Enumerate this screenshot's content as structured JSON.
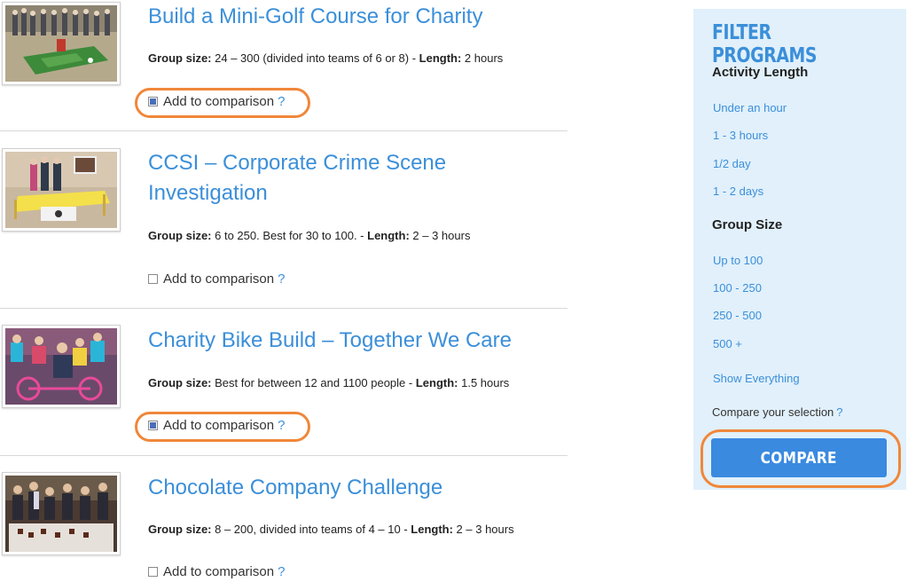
{
  "programs": [
    {
      "title": "Build a Mini-Golf Course for Charity",
      "group_size_label": "Group size:",
      "group_size_value": " 24 – 300 (divided into teams of 6 or 8) - ",
      "length_label": "Length:",
      "length_value": " 2 hours",
      "compare_label": "Add to comparison",
      "help_mark": "?",
      "checked": true
    },
    {
      "title": "CCSI – Corporate Crime Scene Investigation",
      "group_size_label": "Group size:",
      "group_size_value": " 6 to 250. Best for 30 to 100. - ",
      "length_label": "Length:",
      "length_value": " 2 – 3 hours",
      "compare_label": "Add to comparison",
      "help_mark": "?",
      "checked": false
    },
    {
      "title": "Charity Bike Build – Together We Care",
      "group_size_label": "Group size:",
      "group_size_value": " Best for between 12 and 1100 people - ",
      "length_label": "Length:",
      "length_value": " 1.5 hours",
      "compare_label": "Add to comparison",
      "help_mark": "?",
      "checked": true
    },
    {
      "title": "Chocolate Company Challenge",
      "group_size_label": "Group size:",
      "group_size_value": " 8 – 200, divided into teams of 4 – 10 - ",
      "length_label": "Length:",
      "length_value": " 2 – 3 hours",
      "compare_label": "Add to comparison",
      "help_mark": "?",
      "checked": false
    }
  ],
  "filter": {
    "title": "FILTER PROGRAMS",
    "activity_length": {
      "heading": "Activity Length",
      "options": [
        "Under an hour",
        "1 - 3 hours",
        "1/2 day",
        "1 - 2 days"
      ]
    },
    "group_size": {
      "heading": "Group Size",
      "options": [
        "Up to 100",
        "100 - 250",
        "250 - 500",
        "500 +"
      ]
    },
    "show_everything": "Show Everything",
    "compare_selection": "Compare your selection",
    "help_mark": "?",
    "compare_button": "COMPARE"
  },
  "colors": {
    "link": "#3b8fd9",
    "highlight_ring": "#f0873a",
    "filter_bg": "#e1f0fb",
    "button": "#3a8ae0"
  }
}
